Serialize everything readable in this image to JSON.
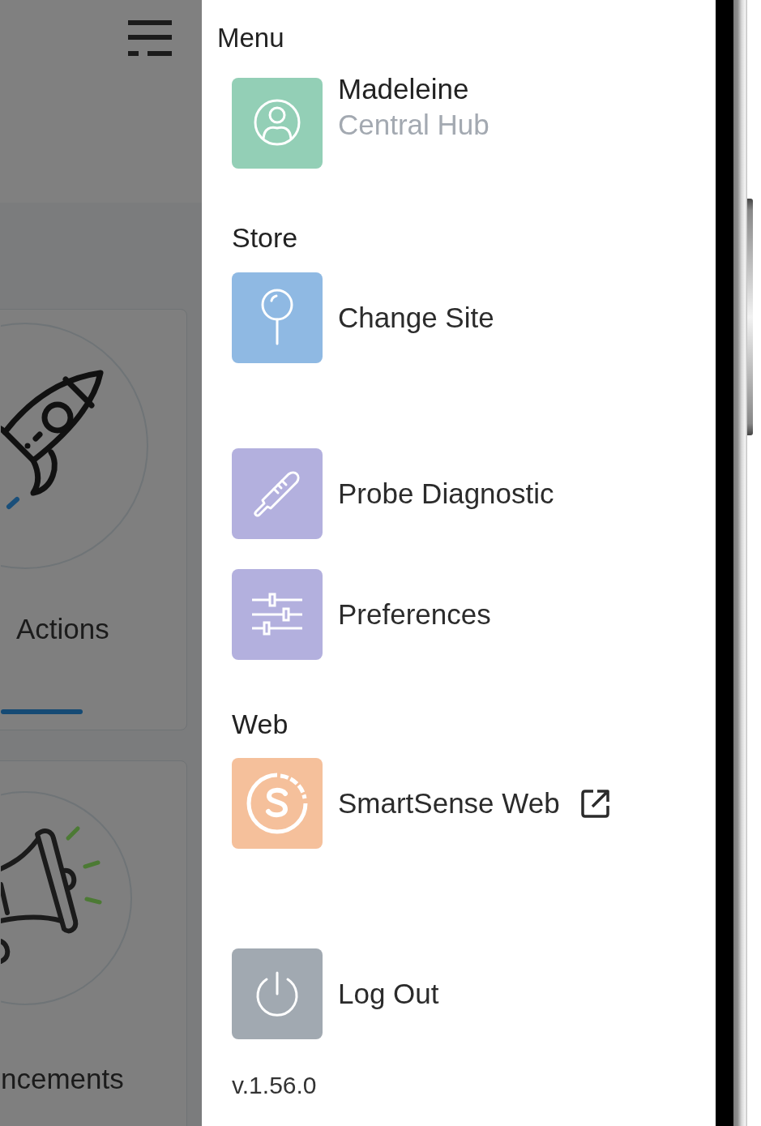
{
  "background_app": {
    "cards": [
      {
        "kind": "rocket",
        "label": "Actions"
      },
      {
        "kind": "megaphone",
        "label": "ncements"
      }
    ]
  },
  "drawer": {
    "title": "Menu",
    "entries": [
      {
        "kind": "profile",
        "name": "Madeleine",
        "subtitle": "Central Hub",
        "color": "#93cfb6"
      },
      {
        "kind": "section",
        "label": "Store"
      },
      {
        "kind": "item",
        "label": "Change Site",
        "color": "#8fb9e3"
      },
      {
        "kind": "item",
        "label": "Probe Diagnostic",
        "color": "#b3b0de"
      },
      {
        "kind": "item",
        "label": "Preferences",
        "color": "#b3b0de"
      },
      {
        "kind": "section",
        "label": "Web"
      },
      {
        "kind": "item",
        "label": "SmartSense Web",
        "color": "#f5c09b",
        "external": true
      },
      {
        "kind": "item",
        "label": "Log Out",
        "color": "#a1a9b1"
      },
      {
        "kind": "version",
        "label": "v.1.56.0"
      }
    ]
  }
}
